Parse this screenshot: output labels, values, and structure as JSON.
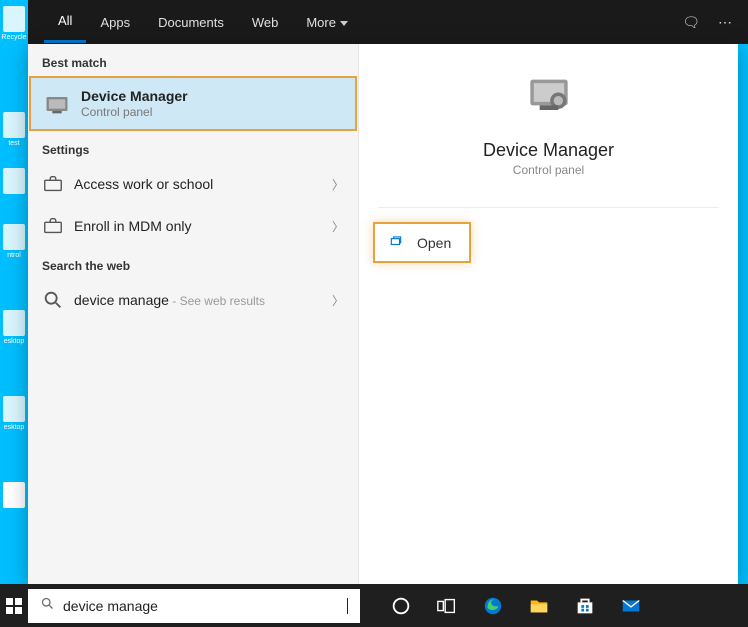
{
  "tabs": {
    "items": [
      "All",
      "Apps",
      "Documents",
      "Web",
      "More"
    ],
    "active_index": 0
  },
  "left": {
    "best_match_header": "Best match",
    "best_match": {
      "title": "Device Manager",
      "subtitle": "Control panel"
    },
    "settings_header": "Settings",
    "settings": [
      {
        "label": "Access work or school"
      },
      {
        "label": "Enroll in MDM only"
      }
    ],
    "web_header": "Search the web",
    "web": {
      "query": "device manage",
      "suffix": " - See web results"
    }
  },
  "right": {
    "title": "Device Manager",
    "subtitle": "Control panel",
    "open_label": "Open"
  },
  "search_value": "device manage",
  "desktop": {
    "labels": [
      "Recycle",
      "test",
      "",
      "ntrol",
      "esktop",
      "esktop",
      ""
    ]
  }
}
